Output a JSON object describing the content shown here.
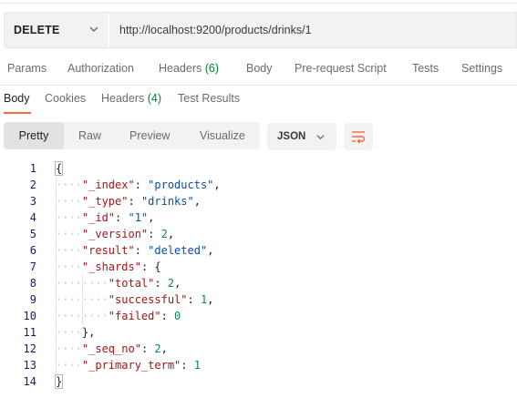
{
  "request": {
    "method": "DELETE",
    "url": "http://localhost:9200/products/drinks/1"
  },
  "request_tabs": [
    {
      "label": "Params",
      "badge": ""
    },
    {
      "label": "Authorization",
      "badge": ""
    },
    {
      "label": "Headers",
      "badge": "(6)"
    },
    {
      "label": "Body",
      "badge": ""
    },
    {
      "label": "Pre-request Script",
      "badge": ""
    },
    {
      "label": "Tests",
      "badge": ""
    },
    {
      "label": "Settings",
      "badge": ""
    }
  ],
  "response_tabs": [
    {
      "label": "Body",
      "badge": "",
      "active": true
    },
    {
      "label": "Cookies",
      "badge": ""
    },
    {
      "label": "Headers",
      "badge": "(4)"
    },
    {
      "label": "Test Results",
      "badge": ""
    }
  ],
  "view_modes": [
    "Pretty",
    "Raw",
    "Preview",
    "Visualize"
  ],
  "active_view": "Pretty",
  "format": "JSON",
  "icons": {
    "method_dropdown": "chevron-down-icon",
    "format_dropdown": "chevron-down-icon",
    "wrap": "wrap-lines-icon"
  },
  "colors": {
    "accent": "#f26b3a",
    "badge": "#0a7d39",
    "key": "#a31515",
    "string": "#0b4ea2",
    "number": "#098658",
    "line_number": "#1a1a6e"
  },
  "code_lines": [
    {
      "n": "1",
      "indent": 0,
      "parts": [
        [
          "punc",
          "{"
        ]
      ]
    },
    {
      "n": "2",
      "indent": 1,
      "parts": [
        [
          "key",
          "\"_index\""
        ],
        [
          "punc",
          ": "
        ],
        [
          "str",
          "\"products\""
        ],
        [
          "punc",
          ","
        ]
      ]
    },
    {
      "n": "3",
      "indent": 1,
      "parts": [
        [
          "key",
          "\"_type\""
        ],
        [
          "punc",
          ": "
        ],
        [
          "str",
          "\"drinks\""
        ],
        [
          "punc",
          ","
        ]
      ]
    },
    {
      "n": "4",
      "indent": 1,
      "parts": [
        [
          "key",
          "\"_id\""
        ],
        [
          "punc",
          ": "
        ],
        [
          "str",
          "\"1\""
        ],
        [
          "punc",
          ","
        ]
      ]
    },
    {
      "n": "5",
      "indent": 1,
      "parts": [
        [
          "key",
          "\"_version\""
        ],
        [
          "punc",
          ": "
        ],
        [
          "num",
          "2"
        ],
        [
          "punc",
          ","
        ]
      ]
    },
    {
      "n": "6",
      "indent": 1,
      "parts": [
        [
          "key",
          "\"result\""
        ],
        [
          "punc",
          ": "
        ],
        [
          "str",
          "\"deleted\""
        ],
        [
          "punc",
          ","
        ]
      ]
    },
    {
      "n": "7",
      "indent": 1,
      "parts": [
        [
          "key",
          "\"_shards\""
        ],
        [
          "punc",
          ": {"
        ]
      ]
    },
    {
      "n": "8",
      "indent": 2,
      "parts": [
        [
          "key",
          "\"total\""
        ],
        [
          "punc",
          ": "
        ],
        [
          "num",
          "2"
        ],
        [
          "punc",
          ","
        ]
      ]
    },
    {
      "n": "9",
      "indent": 2,
      "parts": [
        [
          "key",
          "\"successful\""
        ],
        [
          "punc",
          ": "
        ],
        [
          "num",
          "1"
        ],
        [
          "punc",
          ","
        ]
      ]
    },
    {
      "n": "10",
      "indent": 2,
      "parts": [
        [
          "key",
          "\"failed\""
        ],
        [
          "punc",
          ": "
        ],
        [
          "num",
          "0"
        ]
      ]
    },
    {
      "n": "11",
      "indent": 1,
      "parts": [
        [
          "punc",
          "},"
        ]
      ]
    },
    {
      "n": "12",
      "indent": 1,
      "parts": [
        [
          "key",
          "\"_seq_no\""
        ],
        [
          "punc",
          ": "
        ],
        [
          "num",
          "2"
        ],
        [
          "punc",
          ","
        ]
      ]
    },
    {
      "n": "13",
      "indent": 1,
      "parts": [
        [
          "key",
          "\"_primary_term\""
        ],
        [
          "punc",
          ": "
        ],
        [
          "num",
          "1"
        ]
      ]
    },
    {
      "n": "14",
      "indent": 0,
      "parts": [
        [
          "punc",
          "}"
        ]
      ]
    }
  ]
}
